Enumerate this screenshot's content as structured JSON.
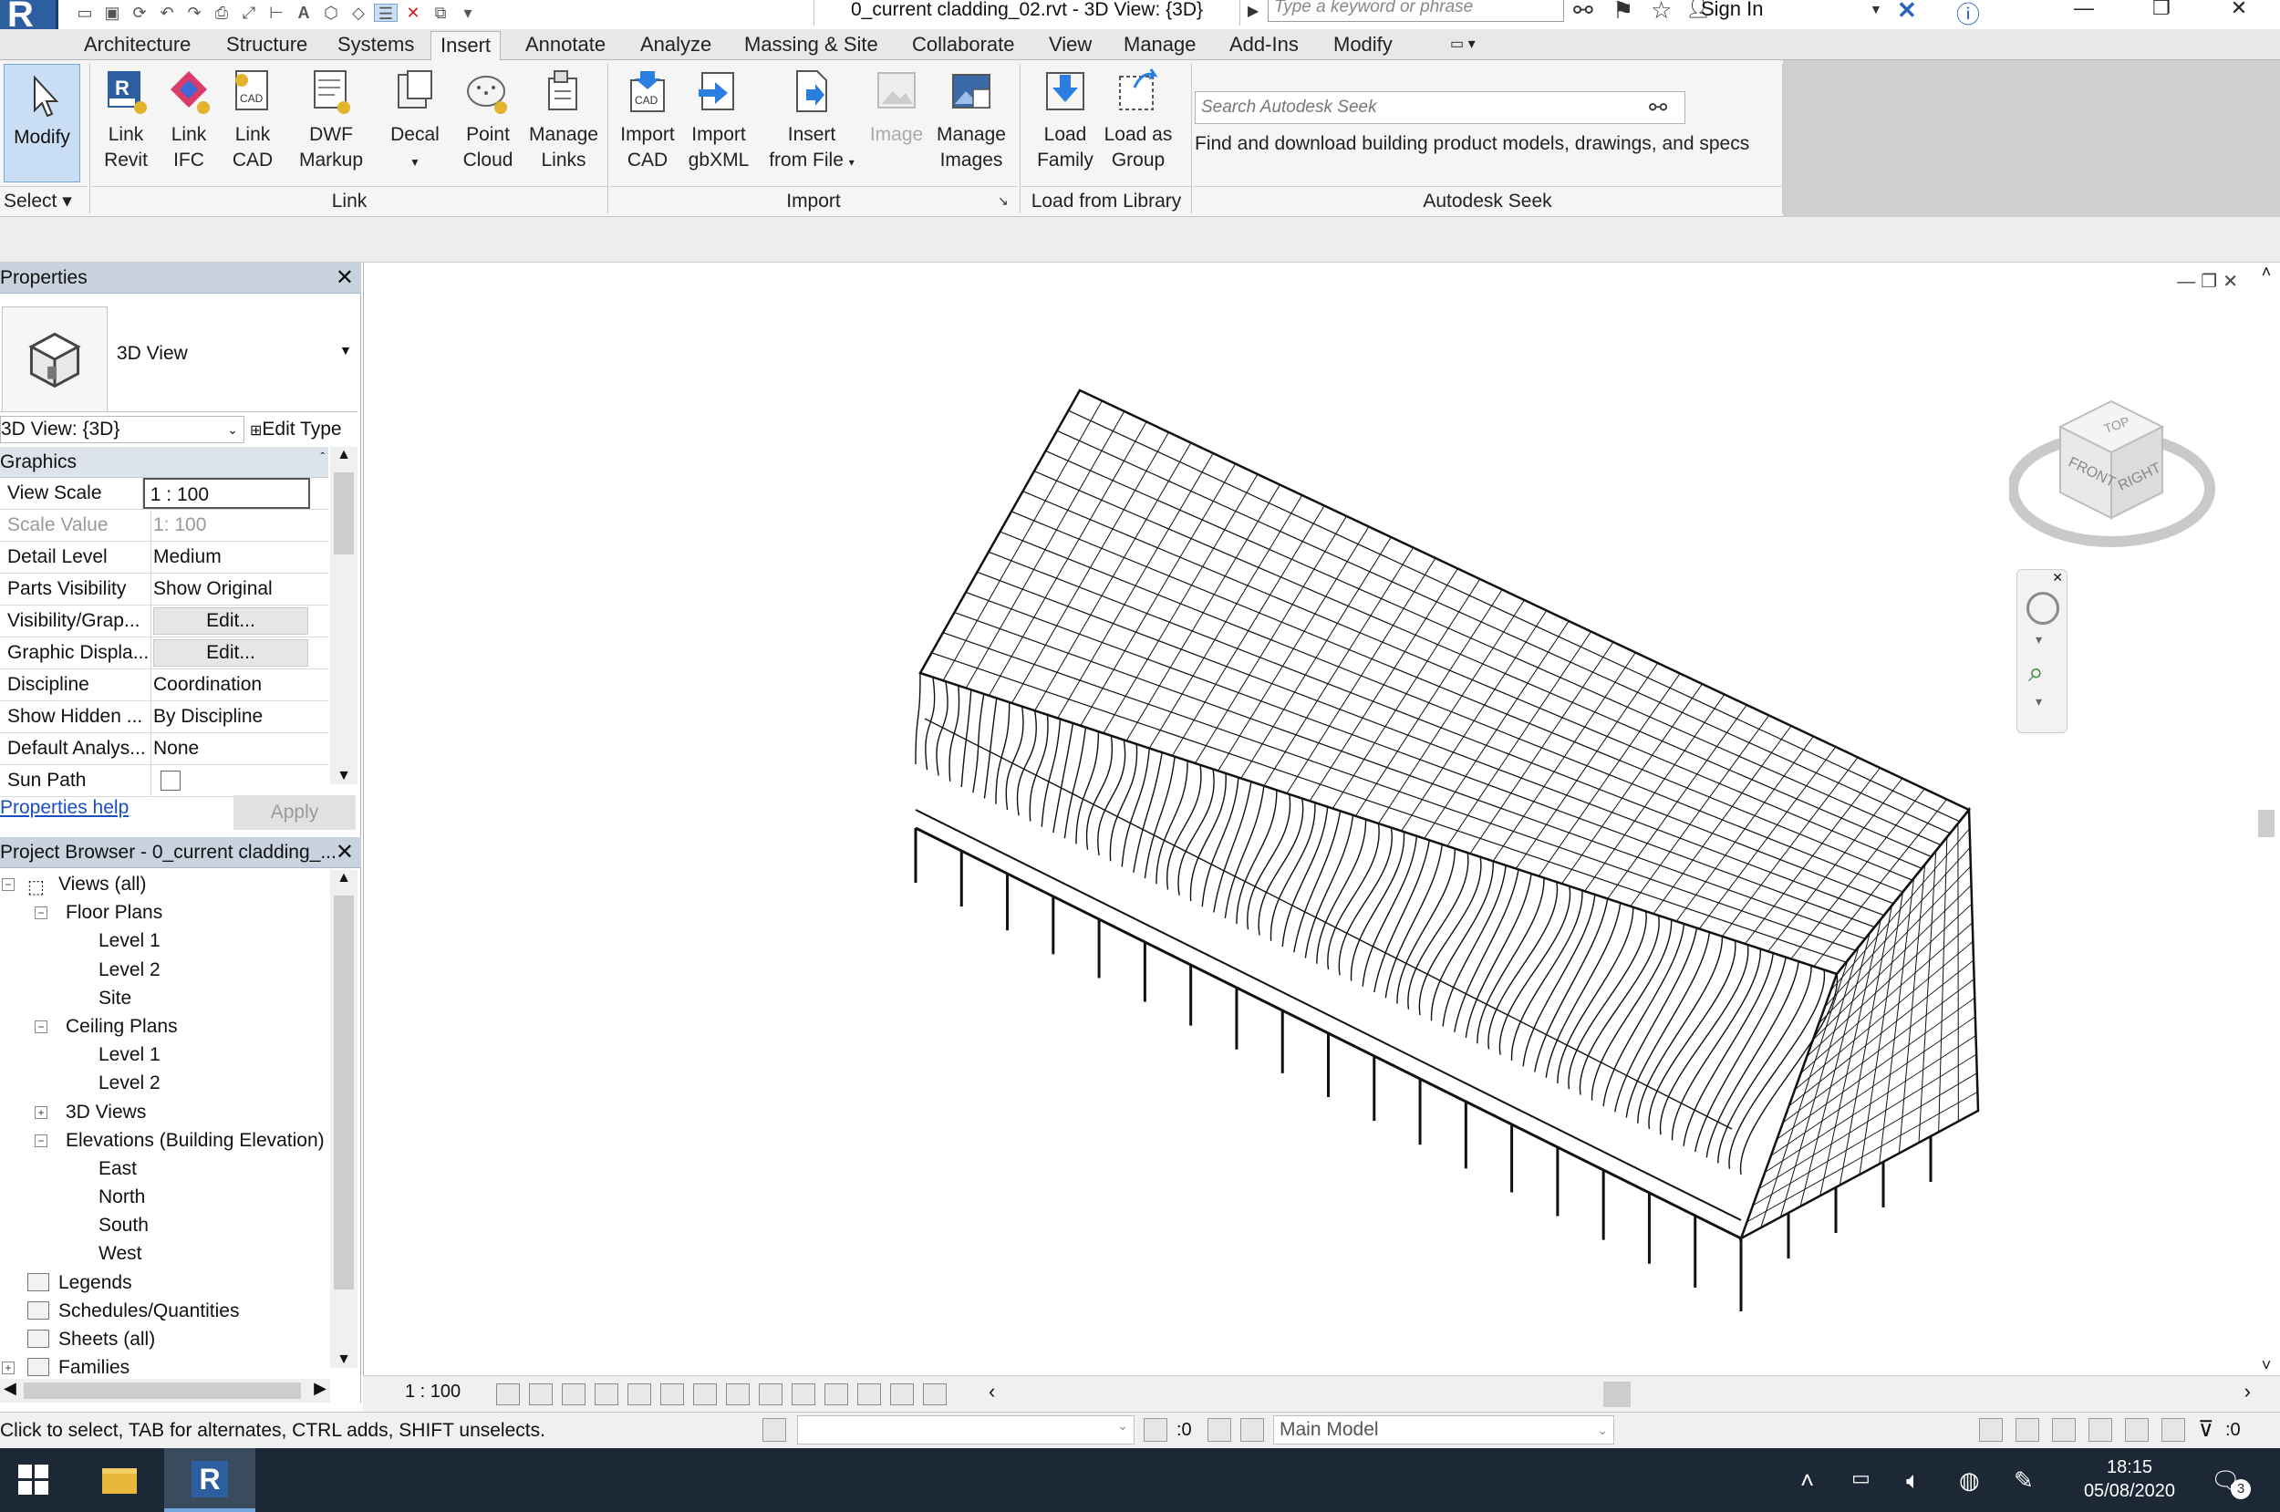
{
  "titlebar": {
    "document_title": "0_current cladding_02.rvt - 3D View: {3D}",
    "search_placeholder": "Type a keyword or phrase",
    "sign_in": "Sign In"
  },
  "ribbon_tabs": [
    "Architecture",
    "Structure",
    "Systems",
    "Insert",
    "Annotate",
    "Analyze",
    "Massing & Site",
    "Collaborate",
    "View",
    "Manage",
    "Add-Ins",
    "Modify"
  ],
  "active_tab": "Insert",
  "ribbon": {
    "modify": "Modify",
    "select_panel": "Select",
    "link_panel": "Link",
    "import_panel": "Import",
    "library_panel": "Load from Library",
    "seek_panel": "Autodesk Seek",
    "buttons": {
      "link_revit": [
        "Link",
        "Revit"
      ],
      "link_ifc": [
        "Link",
        "IFC"
      ],
      "link_cad": [
        "Link",
        "CAD"
      ],
      "dwf_markup": [
        "DWF",
        "Markup"
      ],
      "decal": [
        "Decal",
        ""
      ],
      "point_cloud": [
        "Point",
        "Cloud"
      ],
      "manage_links": [
        "Manage",
        "Links"
      ],
      "import_cad": [
        "Import",
        "CAD"
      ],
      "import_gbxml": [
        "Import",
        "gbXML"
      ],
      "insert_from_file": [
        "Insert",
        "from File"
      ],
      "image": [
        "Image",
        ""
      ],
      "manage_images": [
        "Manage",
        "Images"
      ],
      "load_family": [
        "Load",
        "Family"
      ],
      "load_as_group": [
        "Load as",
        "Group"
      ]
    },
    "seek_placeholder": "Search Autodesk Seek",
    "seek_description": "Find and download building product models, drawings, and specs"
  },
  "properties": {
    "title": "Properties",
    "type_name": "3D View",
    "instance_selector": "3D View: {3D}",
    "edit_type": "Edit Type",
    "group": "Graphics",
    "rows": [
      {
        "name": "View Scale",
        "value": "1 : 100"
      },
      {
        "name": "Scale Value",
        "value": "1:  100"
      },
      {
        "name": "Detail Level",
        "value": "Medium"
      },
      {
        "name": "Parts Visibility",
        "value": "Show Original"
      },
      {
        "name": "Visibility/Grap...",
        "value": "Edit..."
      },
      {
        "name": "Graphic Displa...",
        "value": "Edit..."
      },
      {
        "name": "Discipline",
        "value": "Coordination"
      },
      {
        "name": "Show Hidden ...",
        "value": "By Discipline"
      },
      {
        "name": "Default Analys...",
        "value": "None"
      },
      {
        "name": "Sun Path",
        "value": ""
      }
    ],
    "help_link": "Properties help",
    "apply": "Apply"
  },
  "browser": {
    "title": "Project Browser - 0_current cladding_...",
    "nodes": [
      {
        "label": "Views (all)",
        "level": 0,
        "toggle": "−"
      },
      {
        "label": "Floor Plans",
        "level": 1,
        "toggle": "−"
      },
      {
        "label": "Level 1",
        "level": 2,
        "toggle": ""
      },
      {
        "label": "Level 2",
        "level": 2,
        "toggle": ""
      },
      {
        "label": "Site",
        "level": 2,
        "toggle": ""
      },
      {
        "label": "Ceiling Plans",
        "level": 1,
        "toggle": "−"
      },
      {
        "label": "Level 1",
        "level": 2,
        "toggle": ""
      },
      {
        "label": "Level 2",
        "level": 2,
        "toggle": ""
      },
      {
        "label": "3D Views",
        "level": 1,
        "toggle": "+"
      },
      {
        "label": "Elevations (Building Elevation)",
        "level": 1,
        "toggle": "−"
      },
      {
        "label": "East",
        "level": 2,
        "toggle": ""
      },
      {
        "label": "North",
        "level": 2,
        "toggle": ""
      },
      {
        "label": "South",
        "level": 2,
        "toggle": ""
      },
      {
        "label": "West",
        "level": 2,
        "toggle": ""
      },
      {
        "label": "Legends",
        "level": 0,
        "toggle": ""
      },
      {
        "label": "Schedules/Quantities",
        "level": 0,
        "toggle": ""
      },
      {
        "label": "Sheets (all)",
        "level": 0,
        "toggle": ""
      },
      {
        "label": "Families",
        "level": 0,
        "toggle": "+"
      }
    ]
  },
  "viewcube": {
    "top": "TOP",
    "front": "FRONT",
    "right": "RIGHT"
  },
  "view_control_bar": {
    "scale": "1 : 100"
  },
  "statusbar": {
    "message": "Click to select, TAB for alternates, CTRL adds, SHIFT unselects.",
    "worksets_count": ":0",
    "model": "Main Model",
    "filter_count": ":0"
  },
  "taskbar": {
    "time": "18:15",
    "date": "05/08/2020",
    "notification_count": "3"
  },
  "colors": {
    "ribbon_bg": "#f5f5f5",
    "palette_header": "#c8d3df",
    "taskbar": "#1d2836",
    "link": "#1a4fc4"
  }
}
